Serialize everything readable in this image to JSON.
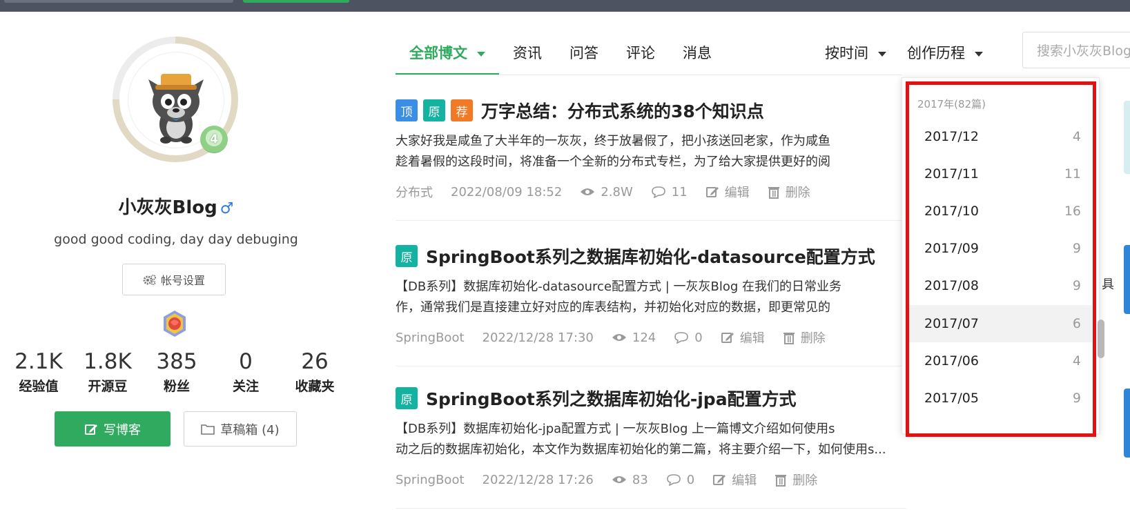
{
  "profile": {
    "name": "小灰灰Blog",
    "gender_symbol": "♂",
    "motto": "good good coding, day day debuging",
    "account_settings_label": "帐号设置",
    "level": "4",
    "stats": [
      {
        "value": "2.1K",
        "label": "经验值"
      },
      {
        "value": "1.8K",
        "label": "开源豆"
      },
      {
        "value": "385",
        "label": "粉丝"
      },
      {
        "value": "0",
        "label": "关注"
      },
      {
        "value": "26",
        "label": "收藏夹"
      }
    ],
    "write_label": "写博客",
    "draft_label": "草稿箱 (4)"
  },
  "tabs": {
    "all_posts": "全部博文",
    "news": "资讯",
    "qa": "问答",
    "comments": "评论",
    "messages": "消息"
  },
  "sort": {
    "by_time": "按时间",
    "history": "创作历程"
  },
  "search": {
    "placeholder": "搜索小灰灰Blog"
  },
  "articles": [
    {
      "tags": [
        "顶",
        "原",
        "荐"
      ],
      "title": "万字总结：分布式系统的38个知识点",
      "summary_line1": "大家好我是咸鱼了大半年的一灰灰，终于放暑假了，把小孩送回老家，作为咸鱼",
      "summary_line2": "趁着暑假的这段时间，将准备一个全新的分布式专栏，为了给大家提供更好的阅",
      "category": "分布式",
      "date": "2022/08/09 18:52",
      "views": "2.8W",
      "comments": "11",
      "edit": "编辑",
      "delete": "删除"
    },
    {
      "tags": [
        "原"
      ],
      "title": "SpringBoot系列之数据库初始化-datasource配置方式",
      "summary_line1": "【DB系列】数据库初始化-datasource配置方式 | 一灰灰Blog 在我们的日常业务",
      "summary_line2": "作，通常我们是直接建立好对应的库表结构，并初始化对应的数据，即更常见的",
      "category": "SpringBoot",
      "date": "2022/12/28 17:30",
      "views": "124",
      "comments": "0",
      "edit": "编辑",
      "delete": "删除"
    },
    {
      "tags": [
        "原"
      ],
      "title": "SpringBoot系列之数据库初始化-jpa配置方式",
      "summary_line1": "【DB系列】数据库初始化-jpa配置方式 | 一灰灰Blog 上一篇博文介绍如何使用s",
      "summary_line2": "动之后的数据库初始化，本文作为数据库初始化的第二篇，将主要介绍一下，如何使用s...",
      "category": "SpringBoot",
      "date": "2022/12/28 17:26",
      "views": "83",
      "comments": "0",
      "edit": "编辑",
      "delete": "删除"
    }
  ],
  "history_dropdown": {
    "year_label": "2017年(82篇)",
    "months": [
      {
        "month": "2017/12",
        "count": "4"
      },
      {
        "month": "2017/11",
        "count": "11"
      },
      {
        "month": "2017/10",
        "count": "16"
      },
      {
        "month": "2017/09",
        "count": "9"
      },
      {
        "month": "2017/08",
        "count": "9"
      },
      {
        "month": "2017/07",
        "count": "6"
      },
      {
        "month": "2017/06",
        "count": "4"
      },
      {
        "month": "2017/05",
        "count": "9"
      }
    ],
    "hovered_index": 5
  },
  "edge_text": "具",
  "colors": {
    "accent_green": "#2faa5f",
    "highlight_red": "#e21212",
    "tag_blue": "#3a8ee6",
    "tag_teal": "#14b3a1",
    "tag_orange": "#f07a26"
  }
}
